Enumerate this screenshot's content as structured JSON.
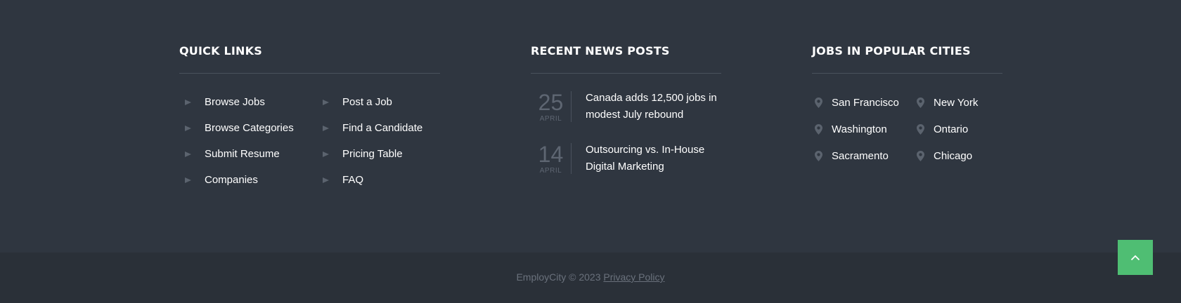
{
  "quick_links": {
    "title": "QUICK LINKS",
    "column1": [
      "Browse Jobs",
      "Browse Categories",
      "Submit Resume",
      "Companies"
    ],
    "column2": [
      "Post a Job",
      "Find a Candidate",
      "Pricing Table",
      "FAQ"
    ]
  },
  "news": {
    "title": "RECENT NEWS POSTS",
    "items": [
      {
        "day": "25",
        "month": "APRIL",
        "title": "Canada adds 12,500 jobs in modest July rebound"
      },
      {
        "day": "14",
        "month": "APRIL",
        "title": "Outsourcing vs. In-House Digital Marketing"
      }
    ]
  },
  "cities": {
    "title": "JOBS IN POPULAR CITIES",
    "column1": [
      "San Francisco",
      "Washington",
      "Sacramento"
    ],
    "column2": [
      "New York",
      "Ontario",
      "Chicago"
    ]
  },
  "footer": {
    "copyright": "EmployCity © 2023",
    "privacy_label": "Privacy Policy"
  },
  "icons": {
    "link_bullet": "triangle-right-icon",
    "city_marker": "map-pin-icon",
    "back_to_top": "chevron-up-icon"
  },
  "colors": {
    "background": "#2f3640",
    "bottom_bar": "#2a3038",
    "accent": "#4fbe73"
  }
}
